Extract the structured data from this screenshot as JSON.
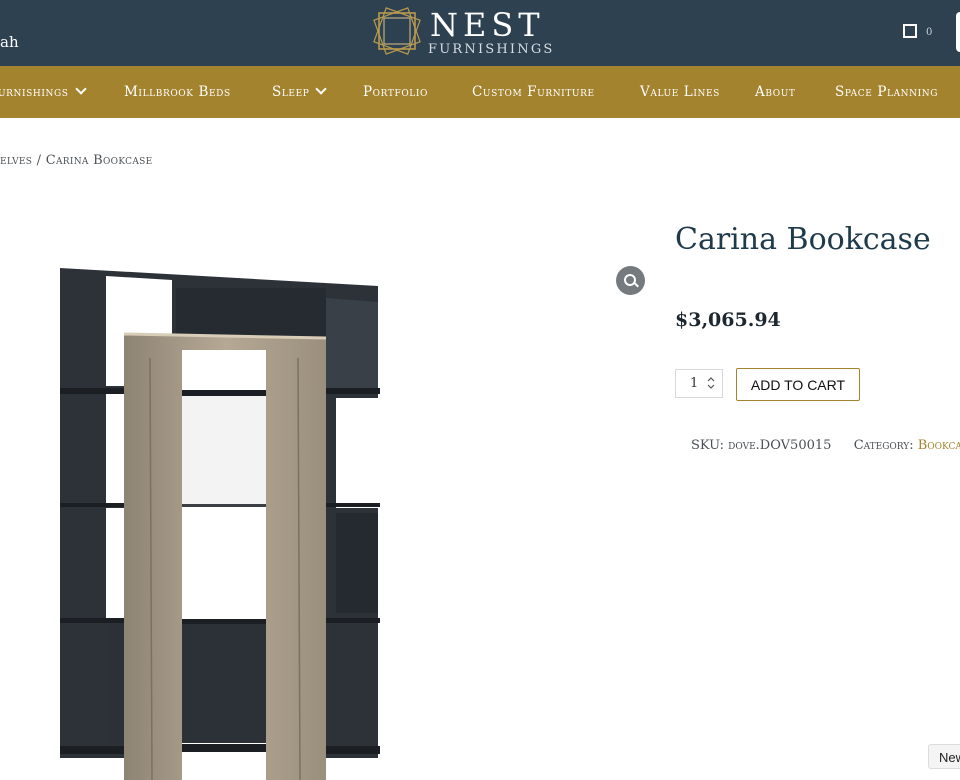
{
  "header": {
    "left_fragment": "ah",
    "brand": {
      "name": "NEST",
      "tagline": "FURNISHINGS"
    },
    "cart_count": "0"
  },
  "nav": {
    "items": [
      {
        "label": "Furnishings",
        "dropdown": true
      },
      {
        "label": "Millbrook Beds",
        "dropdown": false
      },
      {
        "label": "Sleep",
        "dropdown": true
      },
      {
        "label": "Portfolio",
        "dropdown": false
      },
      {
        "label": "Custom Furniture",
        "dropdown": false
      },
      {
        "label": "Value Lines",
        "dropdown": false
      },
      {
        "label": "About",
        "dropdown": false
      },
      {
        "label": "Space Planning",
        "dropdown": false
      }
    ]
  },
  "breadcrumb": "elves / Carina Bookcase",
  "product": {
    "title": "Carina Bookcase",
    "price": "$3,065.94",
    "quantity": "1",
    "add_to_cart": "ADD TO CART",
    "sku_label": "SKU:",
    "sku_value": "dove.DOV50015",
    "category_label": "Category:",
    "category_value": "Bookcas"
  },
  "browser": {
    "new_tab_label": "New"
  },
  "colors": {
    "header_bg": "#2e4150",
    "nav_bg": "#a4832e",
    "title": "#1f3a4a",
    "accent": "#a4832e"
  },
  "icons": [
    "nest-logo-icon",
    "cart-icon",
    "chevron-down-icon",
    "zoom-icon",
    "quantity-spinner-icon"
  ]
}
